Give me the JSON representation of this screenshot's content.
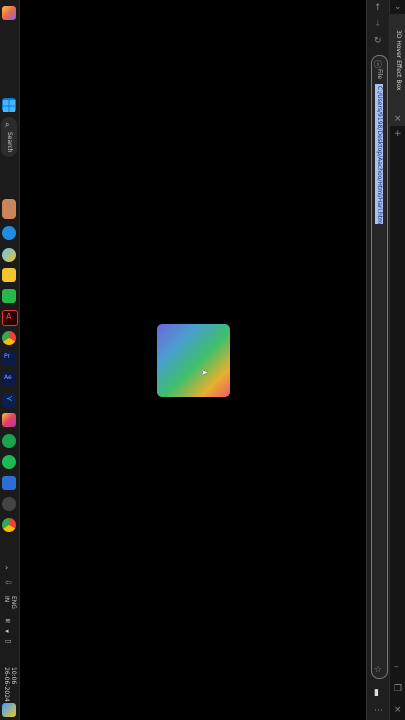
{
  "browser": {
    "tab_title": "3D Hover Effect Box",
    "address_scheme": "File",
    "address_url": "C:/Users/9198/Desktop/Aachoo/Html/Hari.html"
  },
  "taskbar": {
    "search_label": "Search",
    "language_line1": "ENG",
    "language_line2": "IN",
    "time": "10:06",
    "date": "26-06-2024"
  },
  "colors": {
    "taskbar_bg": "#1b1b1b",
    "browser_bg": "#202020",
    "url_highlight": "#a9c2f0",
    "page_bg": "#000000"
  }
}
